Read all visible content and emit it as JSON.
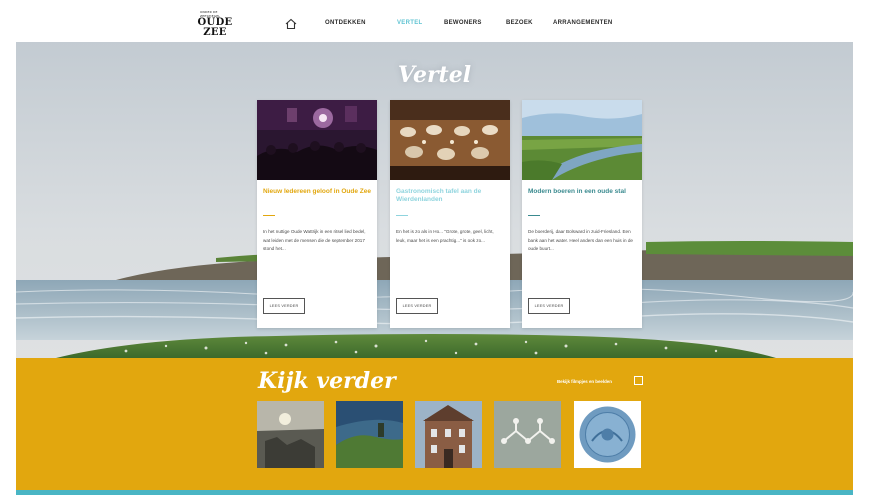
{
  "header": {
    "logo_small": "ONDER DE ZEESPIEGEL",
    "logo_big_1": "OUDE",
    "logo_big_2": "ZEE",
    "nav": [
      {
        "label": "ONTDEKKEN",
        "active": false
      },
      {
        "label": "VERTEL",
        "active": true
      },
      {
        "label": "BEWONERS",
        "active": false
      },
      {
        "label": "BEZOEK",
        "active": false
      },
      {
        "label": "ARRANGEMENTEN",
        "active": false
      }
    ]
  },
  "hero": {
    "title": "Vertel",
    "cards": [
      {
        "title": "Nieuw Iedereen geloof in Oude Zee",
        "title_color": "#e2a70e",
        "body": "In het nuttige Oude Wattrijk in een ritsel lied bedel, wat leiden met de mensen die de september 2017 stond het...",
        "button": "LEES VERDER"
      },
      {
        "title": "Gastronomisch tafel aan de Wierdenlanden",
        "title_color": "#8fd4de",
        "body": "En het is zo als in Ho... \"Grote, grote, geel, licht, leuk, maar het is een prachtig...\" is ook zo...",
        "button": "LEES VERDER"
      },
      {
        "title": "Modern boeren in een oude stal",
        "title_color": "#3a8a8f",
        "body": "De boerderij, daar Bolsward in zuid-Friesland. Een bank aan het water. Heel anders dan een huis in de oude buurt...",
        "button": "LEES VERDER"
      }
    ]
  },
  "band": {
    "title": "Kijk verder",
    "link": "Bekijk filmpjes en beelden"
  },
  "colors": {
    "accent_teal": "#5fc3d2",
    "band_yellow": "#e2a70e",
    "footer_teal": "#49b5c4"
  }
}
